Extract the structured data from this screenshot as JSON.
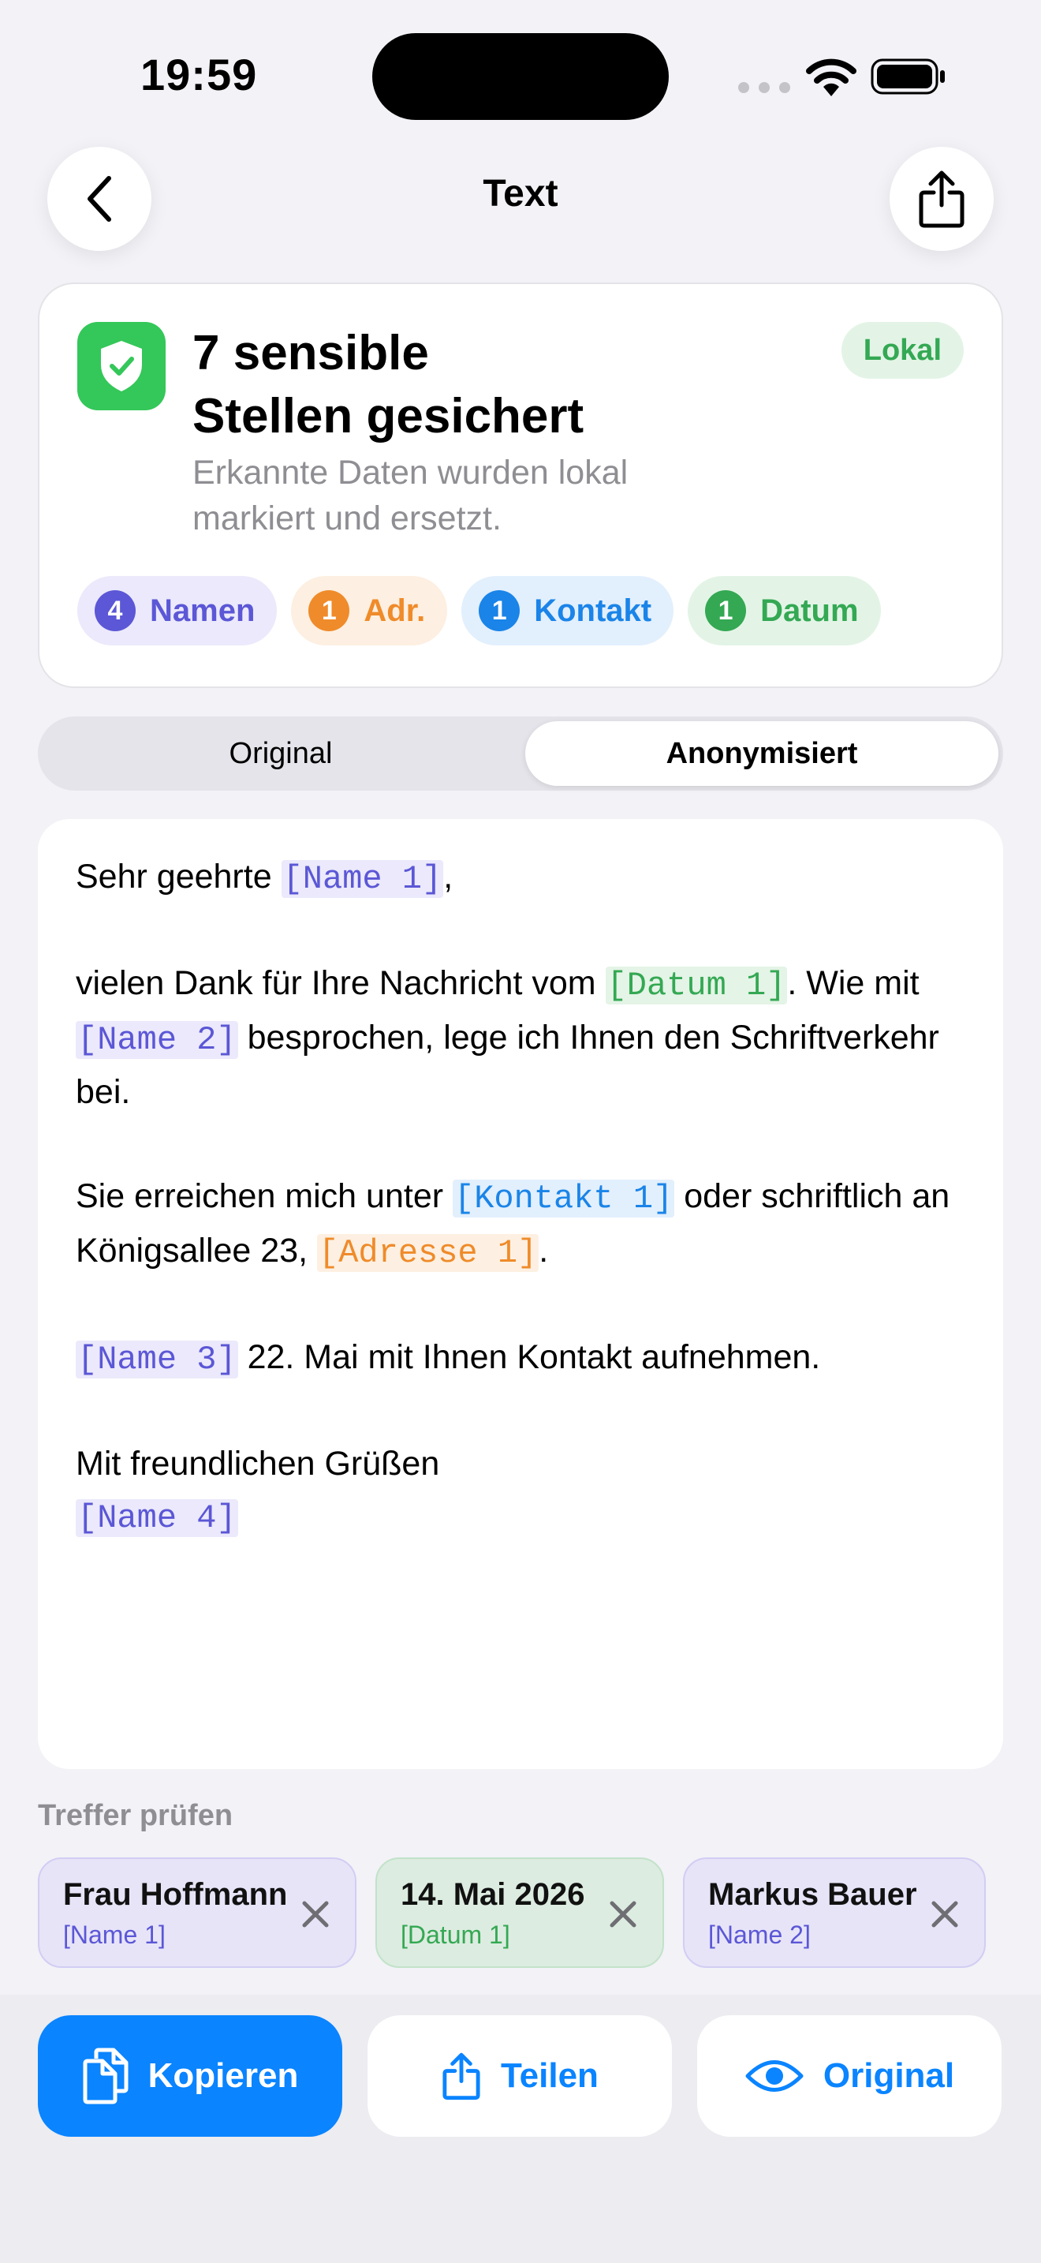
{
  "status": {
    "time": "19:59"
  },
  "nav": {
    "title": "Text"
  },
  "summary": {
    "title_line1": "7 sensible",
    "title_line2": "Stellen gesichert",
    "subtitle_line1": "Erkannte Daten wurden lokal",
    "subtitle_line2": "markiert und ersetzt.",
    "badge": "Lokal",
    "chips": [
      {
        "count": "4",
        "label": "Namen",
        "color": "#5b57d6",
        "bg": "#ebe9fb"
      },
      {
        "count": "1",
        "label": "Adr.",
        "color": "#ef8b2a",
        "bg": "#fdefe1"
      },
      {
        "count": "1",
        "label": "Kontakt",
        "color": "#1a84e8",
        "bg": "#e2effd"
      },
      {
        "count": "1",
        "label": "Datum",
        "color": "#34a853",
        "bg": "#e3f4e6"
      }
    ]
  },
  "segments": {
    "original": "Original",
    "anonymized": "Anonymisiert",
    "selected": "Anonymisiert"
  },
  "document": {
    "p1_pre": "Sehr geehrte ",
    "p1_tag": "[Name 1]",
    "p1_post": ",",
    "p2_pre": "vielen Dank für Ihre Nachricht vom ",
    "p2_tag1": "[Datum 1]",
    "p2_mid1": ". Wie mit ",
    "p2_tag2": "[Name 2]",
    "p2_post": " besprochen, lege ich Ihnen den Schriftverkehr bei.",
    "p3_pre": "Sie erreichen mich unter ",
    "p3_tag1": "[Kontakt 1]",
    "p3_mid": " oder schriftlich an Königsallee 23, ",
    "p3_tag2": "[Adresse 1]",
    "p3_post": ".",
    "p4_tag": "[Name 3]",
    "p4_post": " 22. Mai mit Ihnen Kontakt aufnehmen.",
    "p5_line": "Mit freundlichen Grüßen",
    "p5_tag": "[Name 4]"
  },
  "hits": {
    "label": "Treffer prüfen",
    "items": [
      {
        "value": "Frau Hoffmann",
        "tag": "[Name 1]",
        "kind": "name"
      },
      {
        "value": "14. Mai 2026",
        "tag": "[Datum 1]",
        "kind": "date"
      },
      {
        "value": "Markus Bauer",
        "tag": "[Name 2]",
        "kind": "name"
      }
    ]
  },
  "actions": {
    "copy": "Kopieren",
    "share": "Teilen",
    "original": "Original"
  },
  "colors": {
    "accent": "#0a84ff",
    "success": "#34c759",
    "background": "#f2f2f7"
  }
}
